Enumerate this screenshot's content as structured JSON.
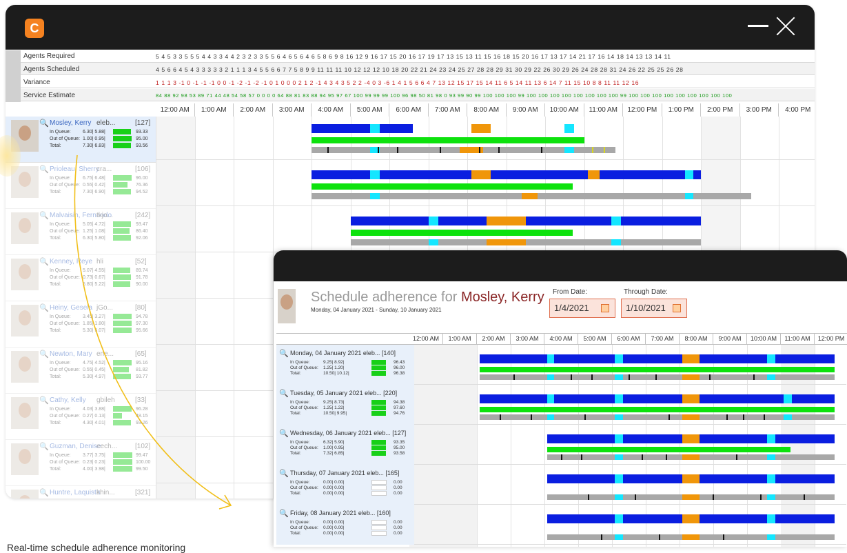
{
  "app": {
    "logo_letter": "C"
  },
  "stats_rows": [
    {
      "label": "Agents Required",
      "values": "5 4 5 3  3 5 5 5 4  4 3 3 4  4 2 3 2  3 3 5 5  6 4 6 5  6 4 6 5  8 6 9 8 16 12 9 16 17 15 20 16 17 19 17 13 15 13 11 15 16 18 15 20 16 17 13 17 14 21 17 16 14 18 14 13 13 14 11"
    },
    {
      "label": "Agents Scheduled",
      "values": "4 5 6 6  4 5 4 3  3 3 3 3  2 1 1 1  3 4 5 5  6 6 7 7  5 8 9 9 11 11 11 10 12 12 12 10 18 20 22 21 24 23 24 25 27 28 28 29 31 30 29 22 26 30 29 26 24 28 28 31 24 26 22 25 25 26 28"
    },
    {
      "label": "Variance",
      "values": "1 1 1 3 -1 0 -1 -1 -1 0 0 -1 -2 -1 -2 -1  0 1 0 0  0 2 1 2 -1 4 3 4  3 5 2 2 -4 0 3 -6  1 4 1 5  6 6 4 7 13 12 15 17 15 14 11 6  5 14 11 13  6 14 7 11 15 10 8 8 11 11 12 16"
    },
    {
      "label": "Service Estimate",
      "values": "84 88 92 98 53 89 71 44 48 54 58 57  0 0 0 0 64 88 81 83 88 94 95 97 67 100 99 99 99 100 96 98 50 81 98 0 93 99 90 99 100 100 100 99 100 100 100 100 100 100 100 100 99 100 100 100 100 100 100 100 100 100"
    }
  ],
  "hours": [
    "12:00 AM",
    "1:00 AM",
    "2:00 AM",
    "3:00 AM",
    "4:00 AM",
    "5:00 AM",
    "6:00 AM",
    "7:00 AM",
    "8:00 AM",
    "9:00 AM",
    "10:00 AM",
    "11:00 AM",
    "12:00 PM",
    "1:00 PM",
    "2:00 PM",
    "3:00 PM",
    "4:00 PM"
  ],
  "agents": [
    {
      "name": "Mosley, Kerry",
      "code": "eleb...",
      "count": "[127]",
      "in_queue": "6.30| 5.88|",
      "in_pct": "93.33",
      "out_queue": "1.00| 0.95|",
      "out_pct": "95.00",
      "total": "7.30| 6.83|",
      "total_pct": "93.56"
    },
    {
      "name": "Prioleau, Sherry",
      "code": "cra...",
      "count": "[106]",
      "in_queue": "6.75| 6.48|",
      "in_pct": "96.00",
      "out_queue": "0.55| 0.42|",
      "out_pct": "76.36",
      "total": "7.30| 6.90|",
      "total_pct": "94.52"
    },
    {
      "name": "Malvaisin, Fernando",
      "code": "tkjo...",
      "count": "[242]",
      "in_queue": "5.05| 4.72|",
      "in_pct": "93.47",
      "out_queue": "1.25| 1.08|",
      "out_pct": "86.40",
      "total": "6.30| 5.80|",
      "total_pct": "92.06"
    },
    {
      "name": "Kenney, Reye",
      "code": "hli",
      "count": "[52]",
      "in_queue": "5.07| 4.55|",
      "in_pct": "89.74",
      "out_queue": "0.73| 0.67|",
      "out_pct": "91.78",
      "total": "5.80| 5.22|",
      "total_pct": "90.00"
    },
    {
      "name": "Heiny, Gesela",
      "code": "jGo...",
      "count": "[80]",
      "in_queue": "3.45| 3.27|",
      "in_pct": "94.78",
      "out_queue": "1.85| 1.80|",
      "out_pct": "97.30",
      "total": "5.30| 5.07|",
      "total_pct": "95.66"
    },
    {
      "name": "Newton, Mary",
      "code": "ene...",
      "count": "[65]",
      "in_queue": "4.75| 4.52|",
      "in_pct": "95.16",
      "out_queue": "0.55| 0.45|",
      "out_pct": "81.82",
      "total": "5.30| 4.97|",
      "total_pct": "93.77"
    },
    {
      "name": "Cathy, Kelly",
      "code": "gbileh",
      "count": "[33]",
      "in_queue": "4.03| 3.88|",
      "in_pct": "96.28",
      "out_queue": "0.27| 0.13|",
      "out_pct": "48.15",
      "total": "4.30| 4.01|",
      "total_pct": "93.26"
    },
    {
      "name": "Guzman, Denise",
      "code": "eech...",
      "count": "[102]",
      "in_queue": "3.77| 3.75|",
      "in_pct": "99.47",
      "out_queue": "0.23| 0.23|",
      "out_pct": "100.00",
      "total": "4.00| 3.98|",
      "total_pct": "99.50"
    },
    {
      "name": "Huntre, Laquista",
      "code": "khin...",
      "count": "[321]",
      "in_queue": "",
      "in_pct": "",
      "out_queue": "",
      "out_pct": "",
      "total": "",
      "total_pct": ""
    }
  ],
  "labels": {
    "in_queue": "In Queue:",
    "out_queue": "Out of Queue:",
    "total": "Total:"
  },
  "detail": {
    "title_prefix": "Schedule adherence for",
    "agent": "Mosley, Kerry",
    "range": "Monday, 04 January 2021 - Sunday, 10 January 2021",
    "from_label": "From Date:",
    "from_value": "1/4/2021",
    "through_label": "Through Date:",
    "through_value": "1/10/2021",
    "hours": [
      "12:00 AM",
      "1:00 AM",
      "2:00 AM",
      "3:00 AM",
      "4:00 AM",
      "5:00 AM",
      "6:00 AM",
      "7:00 AM",
      "8:00 AM",
      "9:00 AM",
      "10:00 AM",
      "11:00 AM",
      "12:00 PM"
    ],
    "days": [
      {
        "date": "Monday, 04 January 2021 eleb... [140]",
        "in_queue": "9.25| 8.92|",
        "in_pct": "96.43",
        "out_queue": "1.25| 1.20|",
        "out_pct": "96.00",
        "total": "10.50| 10.12|",
        "total_pct": "96.38"
      },
      {
        "date": "Tuesday, 05 January 2021 eleb... [220]",
        "in_queue": "9.25| 8.73|",
        "in_pct": "94.38",
        "out_queue": "1.25| 1.22|",
        "out_pct": "97.60",
        "total": "10.50| 9.95|",
        "total_pct": "94.76"
      },
      {
        "date": "Wednesday, 06 January 2021 eleb... [127]",
        "in_queue": "6.32| 5.90|",
        "in_pct": "93.35",
        "out_queue": "1.00| 0.95|",
        "out_pct": "95.00",
        "total": "7.32| 6.85|",
        "total_pct": "93.58"
      },
      {
        "date": "Thursday, 07 January 2021 eleb... [165]",
        "in_queue": "0.00| 0.00|",
        "in_pct": "0.00",
        "out_queue": "0.00| 0.00|",
        "out_pct": "0.00",
        "total": "0.00| 0.00|",
        "total_pct": "0.00"
      },
      {
        "date": "Friday, 08 January 2021 eleb... [160]",
        "in_queue": "0.00| 0.00|",
        "in_pct": "0.00",
        "out_queue": "0.00| 0.00|",
        "out_pct": "0.00",
        "total": "0.00| 0.00|",
        "total_pct": "0.00"
      }
    ]
  },
  "caption": "Real-time schedule adherence monitoring",
  "colors": {
    "scheduled": "#0a1ee0",
    "break": "#f0960a",
    "adherent": "#0de20d",
    "lunch": "#14e6ff",
    "actual": "#a8a8a8"
  }
}
